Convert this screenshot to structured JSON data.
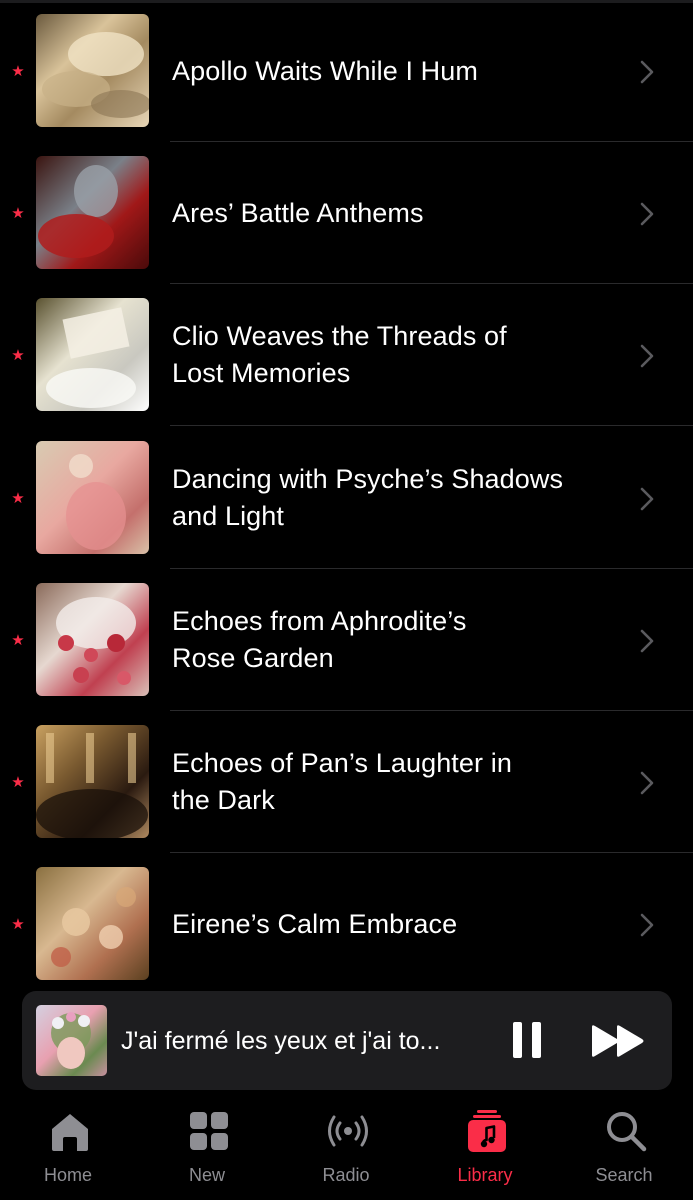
{
  "theme": {
    "accent": "#fa2d48",
    "background": "#000000",
    "mini_player_bg": "#1d1d1f",
    "inactive_tab": "#8e8e93"
  },
  "playlists": [
    {
      "title_lines": [
        "Apollo Waits While I Hum"
      ],
      "favorite": true,
      "art": "cloudy-sky-painting"
    },
    {
      "title_lines": [
        "Ares’ Battle Anthems"
      ],
      "favorite": true,
      "art": "armored-knight-red-cloth-painting"
    },
    {
      "title_lines": [
        "Clio Weaves the Threads of",
        "Lost Memories"
      ],
      "favorite": true,
      "art": "woman-reading-book-painting"
    },
    {
      "title_lines": [
        "Dancing with Psyche’s Shadows",
        "and Light"
      ],
      "favorite": true,
      "art": "dancer-pink-dress-painting"
    },
    {
      "title_lines": [
        "Echoes from Aphrodite’s",
        "Rose Garden"
      ],
      "favorite": true,
      "art": "rose-petals-painting"
    },
    {
      "title_lines": [
        "Echoes of Pan’s Laughter in",
        "the Dark"
      ],
      "favorite": true,
      "art": "ballroom-crowd-painting"
    },
    {
      "title_lines": [
        "Eirene’s Calm Embrace"
      ],
      "favorite": true,
      "art": "cherubs-flowers-painting"
    }
  ],
  "now_playing": {
    "title": "J'ai fermé les yeux et j'ai to...",
    "art": "woman-flower-crown-portrait",
    "pause_icon": "pause-icon",
    "next_icon": "fast-forward-icon"
  },
  "tabs": [
    {
      "label": "Home",
      "icon": "home-icon",
      "active": false
    },
    {
      "label": "New",
      "icon": "grid-icon",
      "active": false
    },
    {
      "label": "Radio",
      "icon": "radio-icon",
      "active": false
    },
    {
      "label": "Library",
      "icon": "library-icon",
      "active": true
    },
    {
      "label": "Search",
      "icon": "search-icon",
      "active": false
    }
  ]
}
